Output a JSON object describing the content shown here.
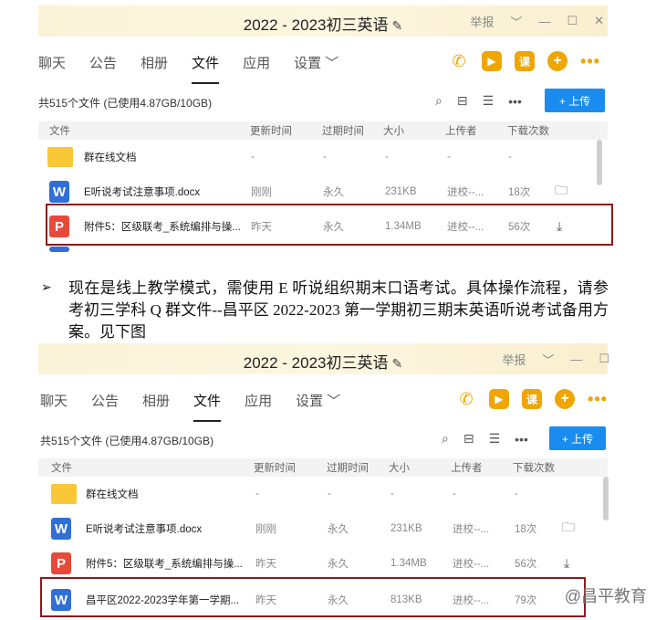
{
  "window": {
    "title": "2022 - 2023初三英语",
    "edit_icon": "✎",
    "report": "举报",
    "chevron": "﹀",
    "minimize": "—",
    "maximize": "☐",
    "close": "✕"
  },
  "tabs": [
    "聊天",
    "公告",
    "相册",
    "文件",
    "应用",
    "设置 ﹀"
  ],
  "active_tab": "文件",
  "file_info": "共515个文件 (已使用4.87GB/10GB)",
  "upload_label": "+ 上传",
  "columns": [
    "文件",
    "更新时间",
    "过期时间",
    "大小",
    "上传者",
    "下载次数"
  ],
  "rows_top": [
    {
      "icon": "folder-icon",
      "name": "群在线文档",
      "updated": "-",
      "expire": "-",
      "size": "-",
      "uploader": "-",
      "downloads": "-"
    },
    {
      "icon": "word-icon",
      "name": "E听说考试注意事项.docx",
      "updated": "刚刚",
      "expire": "永久",
      "size": "231KB",
      "uploader": "进校--...",
      "downloads": "18次"
    },
    {
      "icon": "ppt-icon",
      "name": "附件5：区级联考_系统编排与操...",
      "updated": "昨天",
      "expire": "永久",
      "size": "1.34MB",
      "uploader": "进校--...",
      "downloads": "56次"
    }
  ],
  "rows_bottom": [
    {
      "icon": "folder-icon",
      "name": "群在线文档",
      "updated": "-",
      "expire": "-",
      "size": "-",
      "uploader": "-",
      "downloads": "-"
    },
    {
      "icon": "word-icon",
      "name": "E听说考试注意事项.docx",
      "updated": "刚刚",
      "expire": "永久",
      "size": "231KB",
      "uploader": "进校--...",
      "downloads": "18次"
    },
    {
      "icon": "ppt-icon",
      "name": "附件5：区级联考_系统编排与操...",
      "updated": "昨天",
      "expire": "永久",
      "size": "1.34MB",
      "uploader": "进校--...",
      "downloads": "56次"
    },
    {
      "icon": "word-icon",
      "name": "昌平区2022-2023学年第一学期...",
      "updated": "昨天",
      "expire": "永久",
      "size": "813KB",
      "uploader": "进校--...",
      "downloads": "79次"
    }
  ],
  "paragraph": "现在是线上教学模式，需使用 E 听说组织期末口语考试。具体操作流程，请参考初三学科 Q 群文件--昌平区 2022-2023 第一学期初三期末英语听说考试备用方案。见下图",
  "bullet": "➢",
  "watermark": "@昌平教育",
  "accent_colors": {
    "orange": "#f0a500",
    "blue": "#1a8cf0",
    "highlight": "#8b1a1a"
  }
}
